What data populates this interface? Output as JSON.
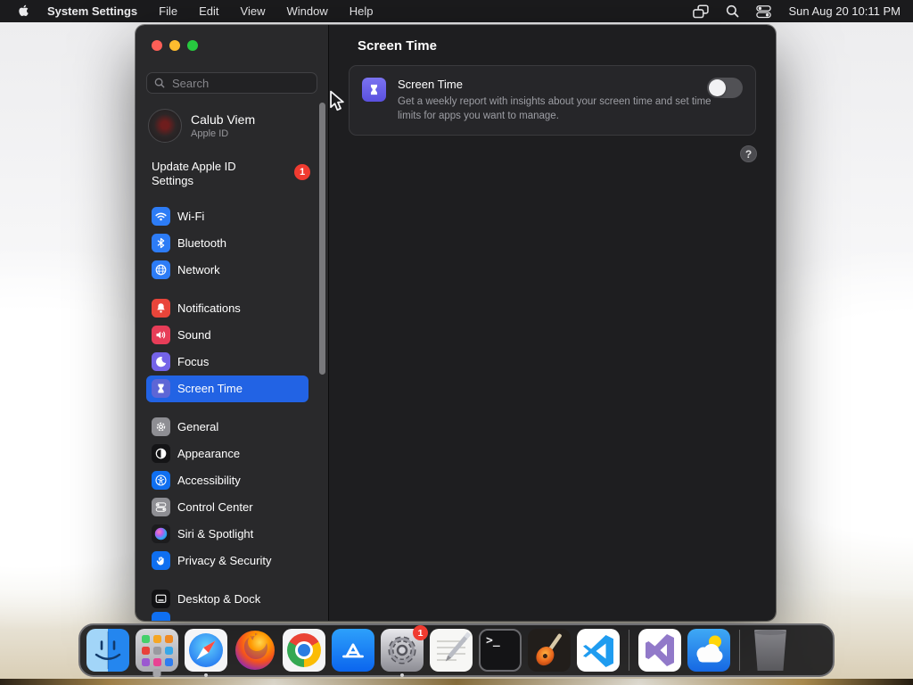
{
  "menu_bar": {
    "app_name": "System Settings",
    "menus": [
      "File",
      "Edit",
      "View",
      "Window",
      "Help"
    ],
    "status_icons": [
      "stage-manager-icon",
      "search-icon",
      "control-center-icon"
    ],
    "clock": "Sun Aug 20  10:11 PM"
  },
  "window": {
    "sidebar": {
      "search_placeholder": "Search",
      "profile": {
        "name": "Calub Viem",
        "subtitle": "Apple ID"
      },
      "update_notice": {
        "label": "Update Apple ID Settings",
        "badge": "1"
      },
      "items": [
        {
          "label": "Wi-Fi",
          "icon": "wifi-icon",
          "tile": "background:#2d7cf6"
        },
        {
          "label": "Bluetooth",
          "icon": "bluetooth-icon",
          "tile": "background:#2d7cf6"
        },
        {
          "label": "Network",
          "icon": "globe-icon",
          "tile": "background:#2d7cf6"
        },
        {
          "label": "Notifications",
          "icon": "bell-icon",
          "tile": "background:#e9453a"
        },
        {
          "label": "Sound",
          "icon": "speaker-icon",
          "tile": "background:#e73d58"
        },
        {
          "label": "Focus",
          "icon": "moon-icon",
          "tile": "background:#7463e8"
        },
        {
          "label": "Screen Time",
          "icon": "hourglass-icon",
          "tile": "background:#5d66d6",
          "selected": true
        },
        {
          "label": "General",
          "icon": "gear-icon",
          "tile": "background:#8e8e93"
        },
        {
          "label": "Appearance",
          "icon": "appearance-icon",
          "tile": "background:#141416"
        },
        {
          "label": "Accessibility",
          "icon": "accessibility-icon",
          "tile": "background:#0f6ff0"
        },
        {
          "label": "Control Center",
          "icon": "control-center-icon",
          "tile": "background:#8e8e93"
        },
        {
          "label": "Siri & Spotlight",
          "icon": "siri-icon",
          "tile": "background:#1c1c1e"
        },
        {
          "label": "Privacy & Security",
          "icon": "hand-icon",
          "tile": "background:#0f6ff0"
        },
        {
          "label": "Desktop & Dock",
          "icon": "desktop-dock-icon",
          "tile": "background:#111113"
        }
      ]
    },
    "content": {
      "title": "Screen Time",
      "card": {
        "title": "Screen Time",
        "description": "Get a weekly report with insights about your screen time and set time limits for apps you want to manage.",
        "toggle_state": "off"
      },
      "help_label": "?"
    }
  },
  "dock": {
    "apps": [
      "Finder",
      "Launchpad",
      "Safari",
      "Firefox",
      "Chrome",
      "App Store",
      "System Settings",
      "Notes",
      "Terminal",
      "GarageBand",
      "VS Code",
      "Visual Studio",
      "Weather",
      "Trash"
    ],
    "settings_badge": "1",
    "terminal_glyph": ">_"
  },
  "colors": {
    "accent_selection": "#2263e4",
    "badge_red": "#f03b30",
    "sidebar_bg": "#29292b",
    "content_bg": "#1e1e20",
    "menubar_bg": "#1b1b1d",
    "toggle_track_off": "#515155"
  }
}
